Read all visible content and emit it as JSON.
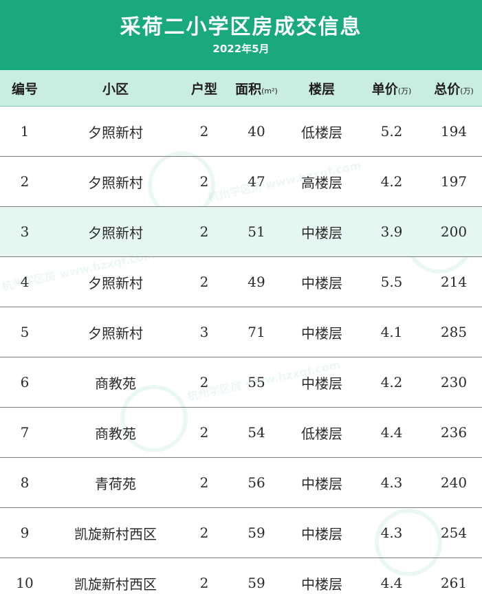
{
  "header": {
    "title": "采荷二小学区房成交信息",
    "subtitle": "2022年5月"
  },
  "columns": [
    {
      "label": "编号",
      "unit": ""
    },
    {
      "label": "小区",
      "unit": ""
    },
    {
      "label": "户型",
      "unit": ""
    },
    {
      "label": "面积",
      "unit": "(m²)"
    },
    {
      "label": "楼层",
      "unit": ""
    },
    {
      "label": "单价",
      "unit": "(万)"
    },
    {
      "label": "总价",
      "unit": "(万)"
    }
  ],
  "rows": [
    {
      "no": "1",
      "name": "夕照新村",
      "type": "2",
      "area": "40",
      "floor": "低楼层",
      "unit_price": "5.2",
      "total": "194"
    },
    {
      "no": "2",
      "name": "夕照新村",
      "type": "2",
      "area": "47",
      "floor": "高楼层",
      "unit_price": "4.2",
      "total": "197"
    },
    {
      "no": "3",
      "name": "夕照新村",
      "type": "2",
      "area": "51",
      "floor": "中楼层",
      "unit_price": "3.9",
      "total": "200"
    },
    {
      "no": "4",
      "name": "夕照新村",
      "type": "2",
      "area": "49",
      "floor": "中楼层",
      "unit_price": "5.5",
      "total": "214"
    },
    {
      "no": "5",
      "name": "夕照新村",
      "type": "3",
      "area": "71",
      "floor": "中楼层",
      "unit_price": "4.1",
      "total": "285"
    },
    {
      "no": "6",
      "name": "商教苑",
      "type": "2",
      "area": "55",
      "floor": "中楼层",
      "unit_price": "4.2",
      "total": "230"
    },
    {
      "no": "7",
      "name": "商教苑",
      "type": "2",
      "area": "54",
      "floor": "低楼层",
      "unit_price": "4.4",
      "total": "236"
    },
    {
      "no": "8",
      "name": "青荷苑",
      "type": "2",
      "area": "56",
      "floor": "中楼层",
      "unit_price": "4.3",
      "total": "240"
    },
    {
      "no": "9",
      "name": "凯旋新村西区",
      "type": "2",
      "area": "59",
      "floor": "中楼层",
      "unit_price": "4.3",
      "total": "254"
    },
    {
      "no": "10",
      "name": "凯旋新村西区",
      "type": "2",
      "area": "59",
      "floor": "中楼层",
      "unit_price": "4.4",
      "total": "261"
    }
  ],
  "watermark": {
    "name": "杭州学区房",
    "url": "www.hzxqf.com"
  },
  "colors": {
    "header_bg": "#1aa97f",
    "column_header_bg": "#c9ede0",
    "highlight_row_bg": "#e6f6f0"
  }
}
